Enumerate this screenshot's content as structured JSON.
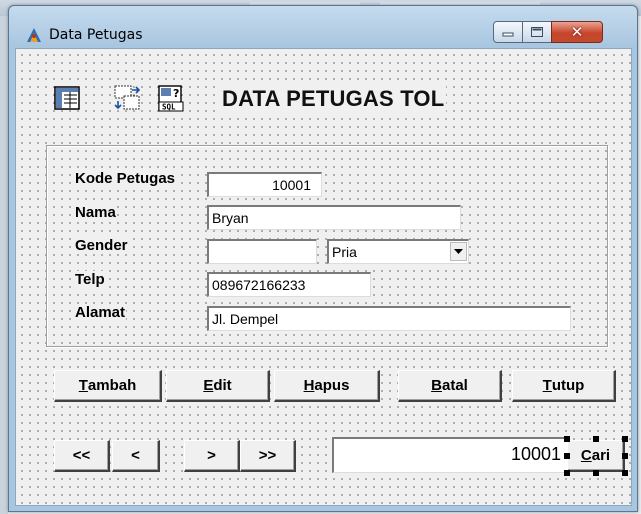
{
  "window": {
    "title": "Data Petugas",
    "close_glyph": "✕"
  },
  "toolbar": {
    "icons": [
      "grid-view-icon",
      "sort-arrows-icon",
      "sql-query-icon"
    ],
    "sql_caption": "SQL"
  },
  "form": {
    "heading": "DATA PETUGAS TOL",
    "fields": {
      "kode_petugas": {
        "label": "Kode Petugas",
        "value": "10001"
      },
      "nama": {
        "label": "Nama",
        "value": "Bryan"
      },
      "gender": {
        "label": "Gender",
        "value": "",
        "selected": "Pria"
      },
      "telp": {
        "label": "Telp",
        "value": "089672166233"
      },
      "alamat": {
        "label": "Alamat",
        "value": "Jl. Dempel"
      }
    }
  },
  "actions": {
    "tambah": {
      "accel": "T",
      "rest": "ambah"
    },
    "edit": {
      "accel": "E",
      "rest": "dit"
    },
    "hapus": {
      "accel": "H",
      "rest": "apus"
    },
    "batal": {
      "accel": "B",
      "rest": "atal"
    },
    "tutup": {
      "accel": "T",
      "rest": "utup"
    }
  },
  "navigation": {
    "first": "<<",
    "prev": "<",
    "next": ">",
    "last": ">>"
  },
  "search": {
    "value": "10001",
    "button": {
      "accel": "C",
      "rest": "ari"
    }
  },
  "colors": {
    "titlebar": "#a9c6e0",
    "close_button": "#c7452c",
    "form_background": "#f0f0f0"
  }
}
